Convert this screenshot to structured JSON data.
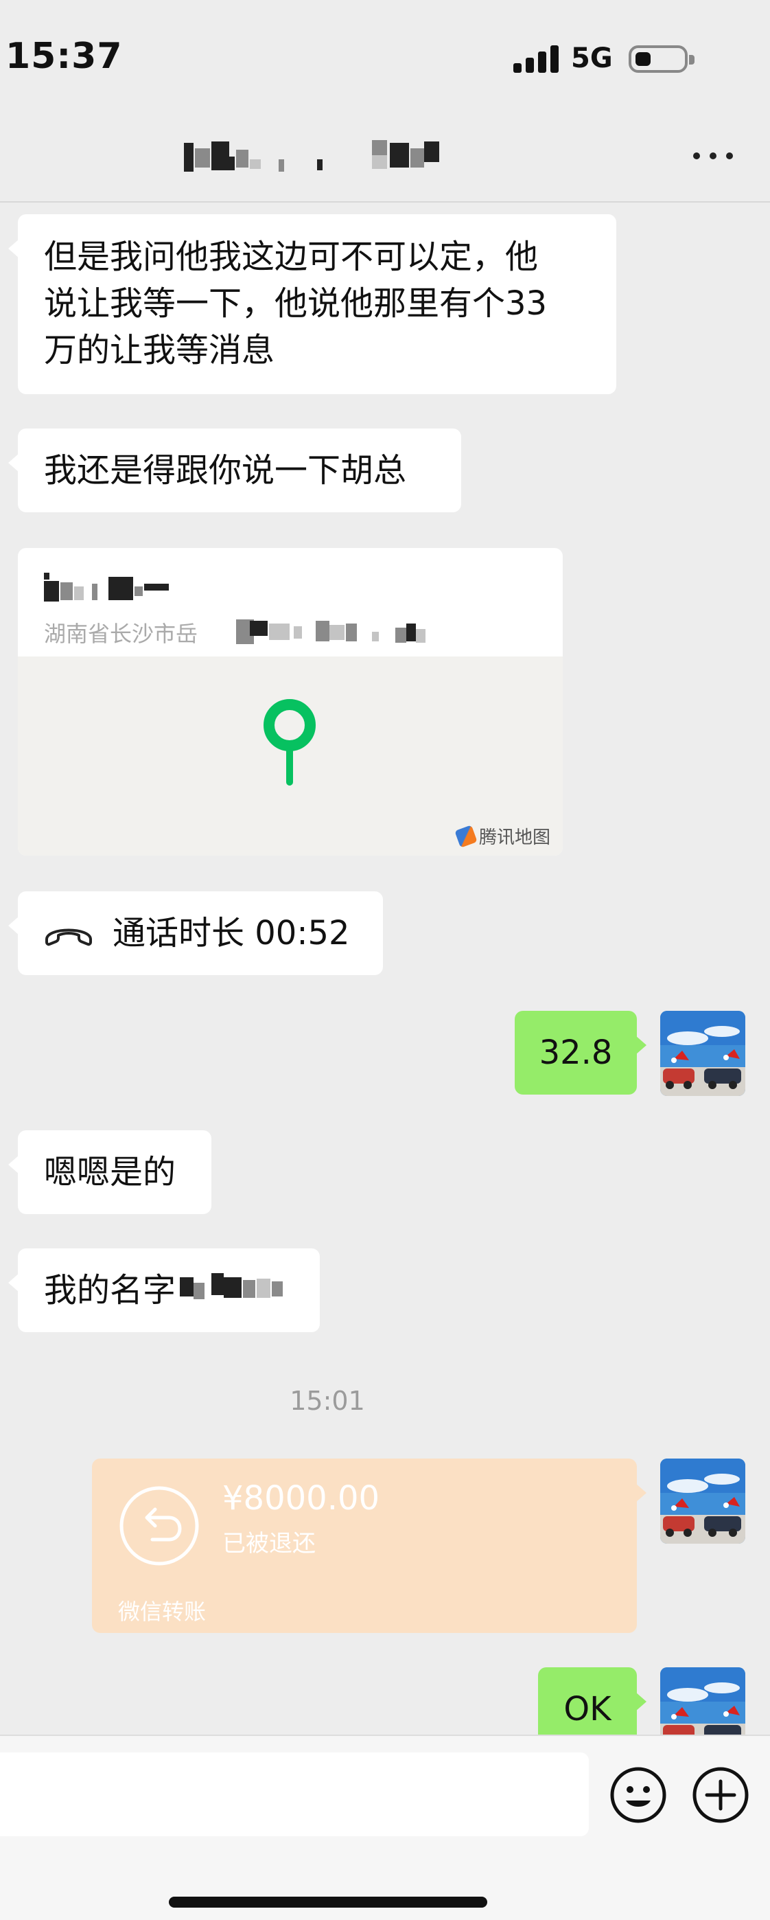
{
  "status_bar": {
    "time": "15:37",
    "network": "5G",
    "signal_bars": 4,
    "battery_level": 0.3
  },
  "nav": {
    "title": "",
    "more_icon": "more-dots-icon"
  },
  "messages": {
    "msg1": {
      "line1": "但是我问他我这边可不可以定，他",
      "line2": "说让我等一下，他说他那里有个33",
      "line3": "万的让我等消息"
    },
    "msg2": "我还是得跟你说一下胡总",
    "location": {
      "address_visible": "湖南省长沙市岳",
      "map_brand": "腾讯地图"
    },
    "call": {
      "text": "通话时长 00:52",
      "icon": "phone-hangup-icon"
    },
    "my_msg1": "32.8",
    "msg3": "嗯嗯是的",
    "msg4_visible": "我的名字",
    "timestamp": "15:01",
    "transfer": {
      "amount": "¥8000.00",
      "status": "已被退还",
      "label": "微信转账",
      "icon": "return-arrow-icon"
    },
    "my_msg2": "OK"
  },
  "input_bar": {
    "placeholder": "",
    "emoji_icon": "emoji-icon",
    "plus_icon": "plus-icon"
  },
  "colors": {
    "background": "#ededed",
    "bubble_received": "#ffffff",
    "bubble_sent": "#95ec69",
    "transfer_returned": "#fbe0c4",
    "map_pin": "#07c160"
  }
}
